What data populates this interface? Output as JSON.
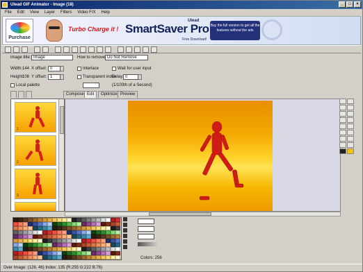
{
  "window": {
    "title": "Ulead GIF Animator - Image (18)",
    "buttons": [
      "_",
      "□",
      "×"
    ]
  },
  "menu": [
    "File",
    "Edit",
    "View",
    "Layer",
    "Filters",
    "Video F/X",
    "Help"
  ],
  "banner": {
    "buy_label": "Purchase",
    "turbo": "Turbo Charge it !",
    "product": "SmartSaver Pro 2.0",
    "product_sub": "Ulead",
    "product_tag": "Free Download!",
    "promo": "Buy the full version to get all the features without the ads"
  },
  "form": {
    "name_label": "Image title:",
    "name_value": "Image",
    "remove_label": "How to remove:",
    "remove_value": "Do Not Remove",
    "width_label": "Width:",
    "width_value": "144",
    "xoffset_label": "X offset:",
    "xoffset_value": "0",
    "height_label": "Height:",
    "height_value": "108",
    "yoffset_label": "Y offset:",
    "yoffset_value": "1",
    "interlace_label": "Interlace",
    "transparent_label": "Transparent index",
    "waitinput_label": "Wait for user input",
    "delay_label": "Delay:",
    "delay_value": "0",
    "delay_unit": "(1/100th of a Second)",
    "localpalette_label": "Local palette"
  },
  "tabs": [
    "Compose",
    "Edit",
    "Optimize",
    "Preview"
  ],
  "active_tab": "Edit",
  "frames": [
    "1",
    "2",
    "3"
  ],
  "color_control": {
    "colors_label": "Colors: 256"
  },
  "status": {
    "text": "Over Image: (126, 46)  Index: 135 (R:255 G:222 B:76)"
  },
  "palette_colors": [
    "#2a1a10",
    "#3a2414",
    "#5a3a20",
    "#7a5028",
    "#9a6a30",
    "#b88038",
    "#d49a40",
    "#e8b04c",
    "#f4c85c",
    "#fadc78",
    "#fff0a0",
    "#fff8d0",
    "#202020",
    "#404040",
    "#606060",
    "#808080",
    "#a0a0a0",
    "#c0c0c0",
    "#e0e0e0",
    "#ffffff",
    "#b02020",
    "#d83030",
    "#f05040",
    "#ff7a60",
    "#ffa080",
    "#20306a",
    "#3a50a0",
    "#5a78c8",
    "#88a8e8",
    "#b8d0f8",
    "#104010",
    "#206a20",
    "#30902e",
    "#58b848",
    "#88d878",
    "#b8f0a8",
    "#6a2a6a",
    "#904a90",
    "#b870b8",
    "#d8a0d8",
    "#5a1a0a",
    "#80301a",
    "#a8482a",
    "#c8603a",
    "#e0784a",
    "#f0905c",
    "#f8b078",
    "#ffc898",
    "#1a4a5a",
    "#2a6a80",
    "#3a8aa8",
    "#60b0d0"
  ]
}
